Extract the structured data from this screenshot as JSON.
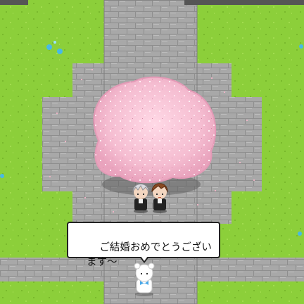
{
  "scene": {
    "name": "cherry-blossom-plaza",
    "grass_color": "#8ccf3a",
    "path_color": "#a9a9a9",
    "blossom_color": "#f7c6d6"
  },
  "dialog": {
    "speaker": "white-bear",
    "text": "ご結婚おめでとうござい\nます～"
  },
  "characters": [
    {
      "id": "silver-haired-groom",
      "outfit": "black suit"
    },
    {
      "id": "brown-haired-groom",
      "outfit": "black suit"
    },
    {
      "id": "white-bear",
      "outfit": "blue bow"
    }
  ],
  "items": [
    {
      "id": "blue-flower-left"
    },
    {
      "id": "blue-flower-right"
    }
  ]
}
